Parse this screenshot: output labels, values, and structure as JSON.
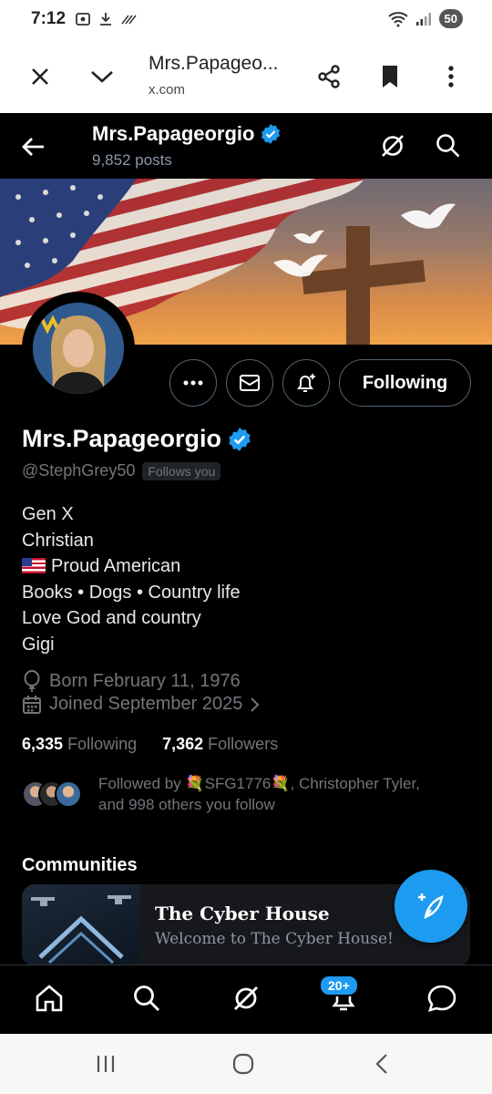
{
  "status_bar": {
    "time": "7:12",
    "battery": "50"
  },
  "browser": {
    "page_title": "Mrs.Papageo...",
    "url": "x.com"
  },
  "header": {
    "name": "Mrs.Papageorgio",
    "posts": "9,852 posts"
  },
  "profile": {
    "name": "Mrs.Papageorgio",
    "handle": "@StephGrey50",
    "follows_you": "Follows you",
    "following_button": "Following",
    "bio": {
      "line1": "Gen X",
      "line2": "Christian",
      "line3": "Proud American",
      "line4": "Books • Dogs • Country life",
      "line5": "Love God and country",
      "line6": "Gigi"
    },
    "born": "Born February 11, 1976",
    "joined": "Joined September 2025",
    "following_count": "6,335",
    "following_label": "Following",
    "followers_count": "7,362",
    "followers_label": "Followers",
    "followed_by_line1": "Followed by 💐SFG1776💐, Christopher Tyler,",
    "followed_by_line2": "and 998 others you follow"
  },
  "communities": {
    "header": "Communities",
    "card": {
      "title": "The Cyber House",
      "subtitle": "Welcome to The Cyber House!"
    }
  },
  "tabbar": {
    "notification_badge": "20+"
  },
  "colors": {
    "accent": "#1d9bf0",
    "background": "#000000",
    "muted": "#71767b"
  }
}
